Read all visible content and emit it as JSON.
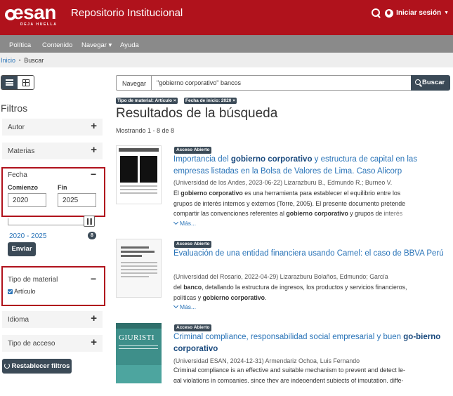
{
  "header": {
    "logo_text": "esan",
    "logo_tagline": "DEJA HUELLA",
    "site_title": "Repositorio Institucional",
    "login_label": "Iniciar sesión"
  },
  "nav": {
    "items": [
      {
        "label": "Política"
      },
      {
        "label": "Contenido"
      },
      {
        "label": "Navegar ▾"
      },
      {
        "label": "Ayuda"
      }
    ]
  },
  "breadcrumb": {
    "home": "Inicio",
    "separator": "•",
    "current": "Buscar"
  },
  "filters": {
    "title": "Filtros",
    "autor": "Autor",
    "materias": "Materias",
    "fecha": {
      "title": "Fecha",
      "start_label": "Comienzo",
      "end_label": "Fin",
      "start_value": "2020",
      "end_value": "2025",
      "range_link": "2020 - 2025",
      "range_count": "8",
      "submit": "Enviar"
    },
    "tipo_material": {
      "title": "Tipo de material",
      "option": "Artículo"
    },
    "idioma": "Idioma",
    "tipo_acceso": "Tipo de acceso",
    "reset": "Restablecer filtros",
    "expand_symbol": "+",
    "collapse_symbol": "−"
  },
  "search": {
    "scope": "Navegar",
    "query": "\"gobierno corporativo\" bancos",
    "button": "Buscar",
    "active_filters": [
      "Tipo de material: Artículo ×",
      "Fecha de inicio: 2020 ×"
    ]
  },
  "results": {
    "title": "Resultados de la búsqueda",
    "showing": "Mostrando 1 - 8 de 8",
    "more_label": "Más...",
    "items": [
      {
        "badge": "Acceso Abierto",
        "title_pre": "Importancia del ",
        "title_bold": "gobierno corporativo",
        "title_post": " y estructura de capital en las empresas listadas en la Bolsa de Valores de Lima. Caso Alicorp",
        "meta": "(Universidad de los Andes, 2023-06-22) Lizarazburu B., Edmundo R.; Burneo V.",
        "abs_l1_pre": "El ",
        "abs_l1_bold": "gobierno corporativo",
        "abs_l1_post": " es una herramienta para establecer el equilibrio entre los",
        "abs_l2": "grupos de interés internos y externos (Torre, 2005). El presente documento pretende",
        "abs_l3_pre": "compartir las convenciones referentes al ",
        "abs_l3_bold": "gobierno corporativo",
        "abs_l3_post": " y grupos de interés"
      },
      {
        "badge": "Acceso Abierto",
        "title": "Evaluación de una entidad financiera usando Camel: el caso de BBVA Perú",
        "meta": "(Universidad del Rosario, 2022-04-29) Lizarazburu Bolaños, Edmundo; García",
        "abs_l1_bold": "banco",
        "abs_l1_pre": "del ",
        "abs_l1_post": ", detallando la estructura de ingresos, los productos y servicios financieros,",
        "abs_l2_pre": "políticas y ",
        "abs_l2_bold": "gobierno corporativo",
        "abs_l2_post": "."
      },
      {
        "badge": "Acceso Abierto",
        "title_pre": "Criminal compliance, responsabilidad social empresarial y buen ",
        "title_bold": "go-bierno corporativo",
        "meta": "(Universidad ESAN, 2024-12-31) Armendariz Ochoa, Luis Fernando",
        "abs_l1": "Criminal compliance is an effective and suitable mechanism to prevent and detect le-",
        "abs_l2": "gal violations in companies, since they are independent subjects of imputation, diffe-",
        "thumb_text": "GIURISTI"
      }
    ]
  },
  "colors": {
    "brand_red": "#b0121c",
    "nav_gray": "#8a8a8a",
    "dark_button": "#3b4a57",
    "link_blue": "#2a74b8"
  }
}
